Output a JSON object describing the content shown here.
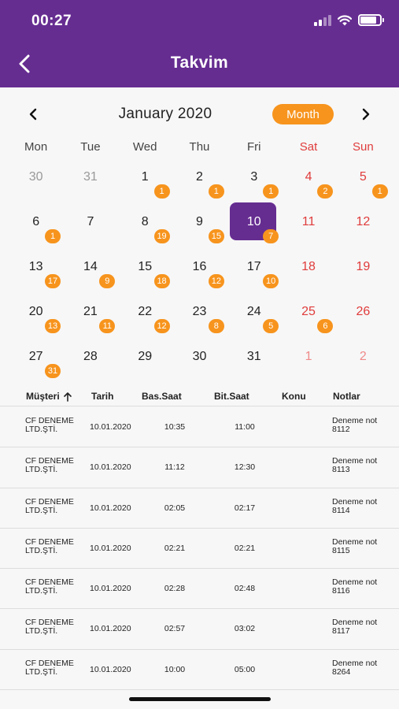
{
  "status_bar": {
    "time": "00:27",
    "battery_level": 0.85
  },
  "header": {
    "title": "Takvim",
    "back_icon": "chevron-left-icon"
  },
  "calendar": {
    "month_label": "January 2020",
    "view_mode_label": "Month",
    "weekdays": [
      "Mon",
      "Tue",
      "Wed",
      "Thu",
      "Fri",
      "Sat",
      "Sun"
    ],
    "weeks": [
      [
        {
          "day": "30",
          "outside": true
        },
        {
          "day": "31",
          "outside": true
        },
        {
          "day": "1",
          "count": "1"
        },
        {
          "day": "2",
          "count": "1"
        },
        {
          "day": "3",
          "count": "1"
        },
        {
          "day": "4",
          "count": "2"
        },
        {
          "day": "5",
          "count": "1"
        }
      ],
      [
        {
          "day": "6",
          "count": "1"
        },
        {
          "day": "7"
        },
        {
          "day": "8",
          "count": "19"
        },
        {
          "day": "9",
          "count": "15"
        },
        {
          "day": "10",
          "count": "7",
          "selected": true
        },
        {
          "day": "11"
        },
        {
          "day": "12"
        }
      ],
      [
        {
          "day": "13",
          "count": "17"
        },
        {
          "day": "14",
          "count": "9"
        },
        {
          "day": "15",
          "count": "18"
        },
        {
          "day": "16",
          "count": "12"
        },
        {
          "day": "17",
          "count": "10"
        },
        {
          "day": "18"
        },
        {
          "day": "19"
        }
      ],
      [
        {
          "day": "20",
          "count": "13"
        },
        {
          "day": "21",
          "count": "11"
        },
        {
          "day": "22",
          "count": "12"
        },
        {
          "day": "23",
          "count": "8"
        },
        {
          "day": "24",
          "count": "5"
        },
        {
          "day": "25",
          "count": "6"
        },
        {
          "day": "26"
        }
      ],
      [
        {
          "day": "27",
          "count": "31"
        },
        {
          "day": "28"
        },
        {
          "day": "29"
        },
        {
          "day": "30"
        },
        {
          "day": "31"
        },
        {
          "day": "1",
          "outside": true
        },
        {
          "day": "2",
          "outside": true
        }
      ]
    ],
    "colors": {
      "accent": "#662d91",
      "badge": "#f7941d",
      "weekend": "#e03c3c"
    }
  },
  "table": {
    "columns": {
      "customer": "Müşteri",
      "date": "Tarih",
      "start": "Bas.Saat",
      "end": "Bit.Saat",
      "subject": "Konu",
      "notes": "Notlar"
    },
    "sort_icon": "arrow-up-icon",
    "rows": [
      {
        "customer": [
          "CF DENEME",
          "LTD.ŞTİ."
        ],
        "date": "10.01.2020",
        "start": "10:35",
        "end": "11:00",
        "subject": "",
        "notes": [
          "Deneme not",
          "8112"
        ]
      },
      {
        "customer": [
          "CF DENEME",
          "LTD.ŞTİ."
        ],
        "date": "10.01.2020",
        "start": "11:12",
        "end": "12:30",
        "subject": "",
        "notes": [
          "Deneme not",
          "8113"
        ]
      },
      {
        "customer": [
          "CF DENEME",
          "LTD.ŞTİ."
        ],
        "date": "10.01.2020",
        "start": "02:05",
        "end": "02:17",
        "subject": "",
        "notes": [
          "Deneme not",
          "8114"
        ]
      },
      {
        "customer": [
          "CF DENEME",
          "LTD.ŞTİ."
        ],
        "date": "10.01.2020",
        "start": "02:21",
        "end": "02:21",
        "subject": "",
        "notes": [
          "Deneme not",
          "8115"
        ]
      },
      {
        "customer": [
          "CF DENEME",
          "LTD.ŞTİ."
        ],
        "date": "10.01.2020",
        "start": "02:28",
        "end": "02:48",
        "subject": "",
        "notes": [
          "Deneme not",
          "8116"
        ]
      },
      {
        "customer": [
          "CF DENEME",
          "LTD.ŞTİ."
        ],
        "date": "10.01.2020",
        "start": "02:57",
        "end": "03:02",
        "subject": "",
        "notes": [
          "Deneme not",
          "8117"
        ]
      },
      {
        "customer": [
          "CF DENEME",
          "LTD.ŞTİ."
        ],
        "date": "10.01.2020",
        "start": "10:00",
        "end": "05:00",
        "subject": "",
        "notes": [
          "Deneme not",
          "8264"
        ]
      }
    ]
  }
}
